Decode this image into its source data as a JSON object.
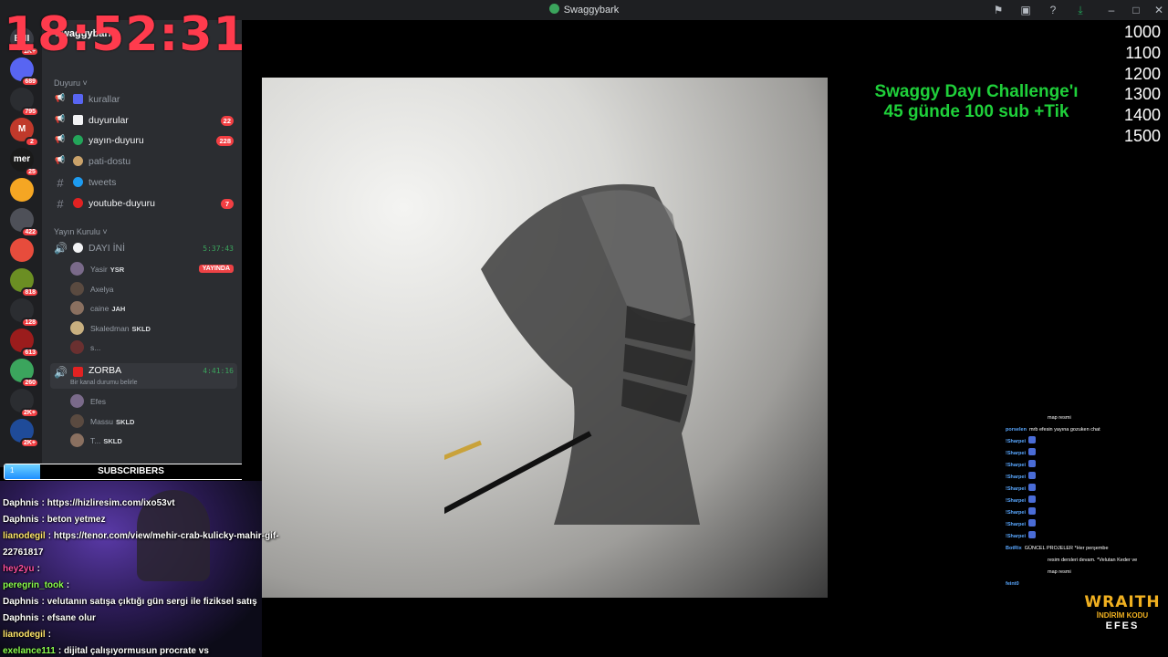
{
  "window": {
    "title": "Swaggybark"
  },
  "overlay": {
    "clock": "18:52:31",
    "challenge_line1": "Swaggy Dayı Challenge'ı",
    "challenge_line2": "45 günde 100 sub +Tik",
    "goals": [
      "1000",
      "1100",
      "1200",
      "1300",
      "1400",
      "1500"
    ],
    "subscribers": {
      "label": "SUBSCRIBERS",
      "start": "1",
      "goal": "7",
      "progress": 0.14
    },
    "brand": {
      "name": "WRAITH",
      "code_label": "İNDİRİM KODU",
      "code": "EFES"
    }
  },
  "servers": [
    {
      "name": "ENI",
      "badge": "1K+",
      "color": "#3a3c44"
    },
    {
      "name": "",
      "badge": "689",
      "color": "#5865f2"
    },
    {
      "name": "",
      "badge": "795",
      "color": "#2b2d31"
    },
    {
      "name": "M",
      "badge": "2",
      "color": "#c0392b"
    },
    {
      "name": "mer",
      "badge": "25",
      "color": "#1a1a1a"
    },
    {
      "name": "",
      "badge": "",
      "color": "#f5a623"
    },
    {
      "name": "",
      "badge": "422",
      "color": "#4e5058"
    },
    {
      "name": "",
      "badge": "",
      "color": "#e74c3c"
    },
    {
      "name": "",
      "badge": "818",
      "color": "#6b8e23"
    },
    {
      "name": "",
      "badge": "128",
      "color": "#2b2d31"
    },
    {
      "name": "",
      "badge": "613",
      "color": "#9b1c1c"
    },
    {
      "name": "",
      "badge": "260",
      "color": "#3ba55d"
    },
    {
      "name": "",
      "badge": "2K+",
      "color": "#2b2d31"
    },
    {
      "name": "",
      "badge": "2K+",
      "color": "#1f4b99"
    }
  ],
  "sidebar": {
    "server_name": "Swaggybark",
    "categories": {
      "announce": "Duyuru",
      "stream": "Yayın Kurulu"
    },
    "channels": [
      {
        "name": "kurallar",
        "count": "",
        "unread": false,
        "emoji_color": "#5865f2"
      },
      {
        "name": "duyurular",
        "count": "22",
        "unread": true,
        "emoji_color": "#f2f3f5"
      },
      {
        "name": "yayın-duyuru",
        "count": "228",
        "unread": true,
        "emoji_color": "#23a55a"
      },
      {
        "name": "pati-dostu",
        "count": "",
        "unread": false,
        "emoji_color": "#caa26a"
      },
      {
        "name": "tweets",
        "count": "",
        "unread": false,
        "emoji_color": "#1d9bf0"
      },
      {
        "name": "youtube-duyuru",
        "count": "7",
        "unread": true,
        "emoji_color": "#e22222"
      }
    ],
    "voice1": {
      "name": "DAYI İNİ",
      "time": "5:37:43",
      "users": [
        {
          "name": "Yasir",
          "tag": "YSR",
          "live": "YAYINDA"
        },
        {
          "name": "Axelya",
          "tag": "",
          "live": ""
        },
        {
          "name": "caine",
          "tag": "JAH",
          "live": ""
        },
        {
          "name": "Skaledman",
          "tag": "SKLD",
          "live": ""
        },
        {
          "name": "s...",
          "tag": "",
          "live": ""
        }
      ]
    },
    "voice2": {
      "name": "ZORBA",
      "time": "4:41:16",
      "status": "Bir kanal durumu belirle",
      "users": [
        {
          "name": "Efes",
          "tag": ""
        },
        {
          "name": "Massu",
          "tag": "SKLD"
        },
        {
          "name": "T...",
          "tag": "SKLD"
        }
      ]
    }
  },
  "chat": [
    {
      "user": "Daphnis",
      "color": "#ffffff",
      "text": "https://hizliresim.com/ixo53vt"
    },
    {
      "user": "Daphnis",
      "color": "#ffffff",
      "text": "beton yetmez"
    },
    {
      "user": "lianodegil",
      "color": "#ffe66b",
      "text": "https://tenor.com/view/mehir-crab-kulicky-mahir-gif-"
    },
    {
      "user": "",
      "color": "#ffffff",
      "text": "22761817"
    },
    {
      "user": "hey2yu",
      "color": "#ff4fa0",
      "text": ""
    },
    {
      "user": "peregrin_took",
      "color": "#8cff4f",
      "text": ""
    },
    {
      "user": "Daphnis",
      "color": "#ffffff",
      "text": "velutanın satışa çıktığı gün sergi ile fiziksel satış"
    },
    {
      "user": "Daphnis",
      "color": "#ffffff",
      "text": "efsane olur"
    },
    {
      "user": "lianodegil",
      "color": "#ffe66b",
      "text": ""
    },
    {
      "user": "exelance111",
      "color": "#8cff4f",
      "text": "dijital çalışıyormusun procrate vs"
    }
  ],
  "right_chat": [
    {
      "user": "",
      "text": "map resmi"
    },
    {
      "user": "porselen",
      "text": "mrb efesin yayına gozuken chat"
    },
    {
      "user": "!Sharpei",
      "text": ""
    },
    {
      "user": "!Sharpei",
      "text": ""
    },
    {
      "user": "!Sharpei",
      "text": ""
    },
    {
      "user": "!Sharpei",
      "text": ""
    },
    {
      "user": "!Sharpei",
      "text": ""
    },
    {
      "user": "!Sharpei",
      "text": ""
    },
    {
      "user": "!Sharpei",
      "text": ""
    },
    {
      "user": "!Sharpei",
      "text": ""
    },
    {
      "user": "!Sharpei",
      "text": ""
    },
    {
      "user": "BotRix",
      "text": "GÜNCEL PROJELER *Her perşembe"
    },
    {
      "user": "",
      "text": "resim dersleri devam. *Velutan Keder ve"
    },
    {
      "user": "",
      "text": "map resmi"
    },
    {
      "user": "feint0",
      "text": ""
    }
  ]
}
